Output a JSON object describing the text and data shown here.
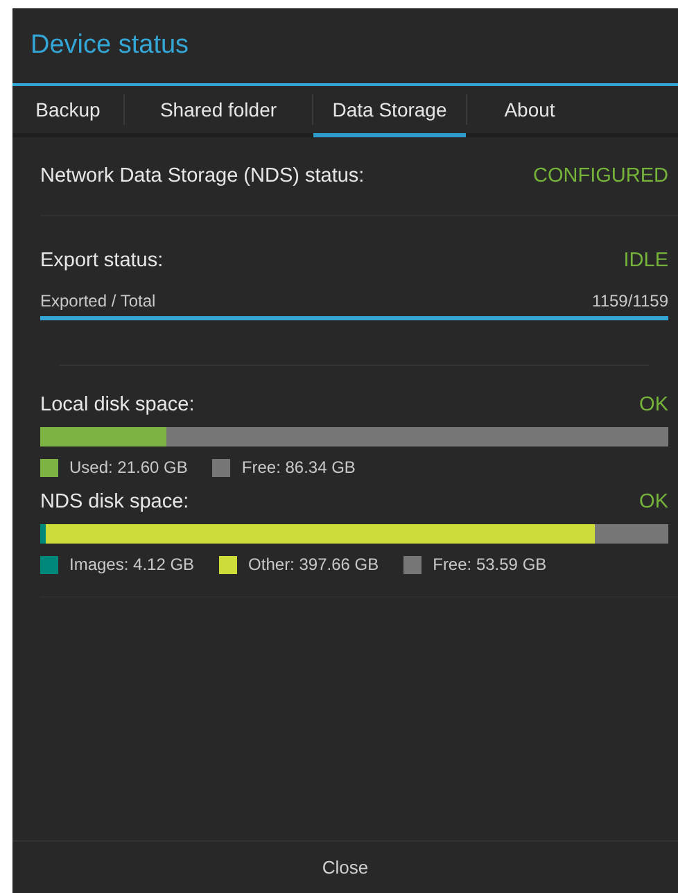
{
  "window": {
    "title": "Device status"
  },
  "tabs": [
    {
      "label": "Backup",
      "selected": false
    },
    {
      "label": "Shared folder",
      "selected": false
    },
    {
      "label": "Data Storage",
      "selected": true
    },
    {
      "label": "About",
      "selected": false
    }
  ],
  "nds_status": {
    "label": "Network Data Storage (NDS) status:",
    "value": "CONFIGURED"
  },
  "export": {
    "label": "Export status:",
    "value": "IDLE",
    "progress_label": "Exported / Total",
    "reading": "1159/1159",
    "level": 1
  },
  "disks": [
    {
      "label": "Local disk space:",
      "status": "OK",
      "segments": [
        {
          "label": "Used: 21.60 GB",
          "color": "#7cb342",
          "level": 0.2
        },
        {
          "label": "Free: 86.34 GB",
          "color": "#777777",
          "level": 0.8
        }
      ]
    },
    {
      "label": "NDS disk space:",
      "status": "OK",
      "segments": [
        {
          "label": "Images: 4.12 GB",
          "color": "#00897b",
          "level": 0.009
        },
        {
          "label": "Other: 397.66 GB",
          "color": "#cddc39",
          "level": 0.873
        },
        {
          "label": "Free: 53.59 GB",
          "color": "#777777",
          "level": 0.118
        }
      ]
    }
  ],
  "button": "Close"
}
